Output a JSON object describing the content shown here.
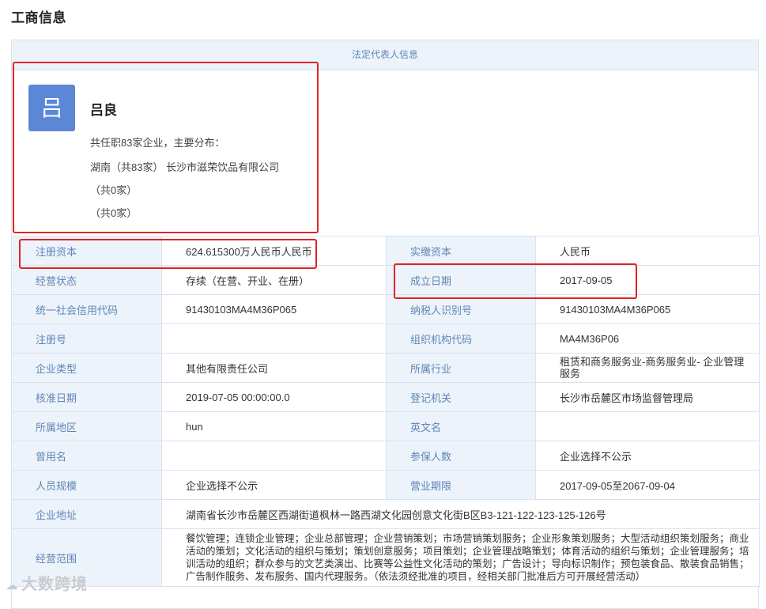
{
  "page_title": "工商信息",
  "section_header": "法定代表人信息",
  "person": {
    "avatar_char": "吕",
    "name": "吕良",
    "summary": "共任职83家企业，主要分布：",
    "lines": [
      "湖南（共83家） 长沙市滋荣饮品有限公司",
      "（共0家）",
      "（共0家）"
    ]
  },
  "fields": {
    "reg_capital": {
      "label": "注册资本",
      "value": "624.615300万人民币人民币"
    },
    "paid_capital": {
      "label": "实缴资本",
      "value": "人民币"
    },
    "status": {
      "label": "经营状态",
      "value": "存续（在营、开业、在册）"
    },
    "founded": {
      "label": "成立日期",
      "value": "2017-09-05"
    },
    "credit_code": {
      "label": "统一社会信用代码",
      "value": "91430103MA4M36P065"
    },
    "taxpayer_id": {
      "label": "纳税人识别号",
      "value": "91430103MA4M36P065"
    },
    "reg_no": {
      "label": "注册号",
      "value": ""
    },
    "org_code": {
      "label": "组织机构代码",
      "value": "MA4M36P06"
    },
    "company_type": {
      "label": "企业类型",
      "value": "其他有限责任公司"
    },
    "industry": {
      "label": "所属行业",
      "value": "租赁和商务服务业-商务服务业- 企业管理服务"
    },
    "approval_date": {
      "label": "核准日期",
      "value": "2019-07-05 00:00:00.0"
    },
    "authority": {
      "label": "登记机关",
      "value": "长沙市岳麓区市场监督管理局"
    },
    "region": {
      "label": "所属地区",
      "value": "hun"
    },
    "english_name": {
      "label": "英文名",
      "value": ""
    },
    "former_name": {
      "label": "曾用名",
      "value": ""
    },
    "insured": {
      "label": "参保人数",
      "value": "企业选择不公示"
    },
    "staff_size": {
      "label": "人员规模",
      "value": "企业选择不公示"
    },
    "term": {
      "label": "营业期限",
      "value": "2017-09-05至2067-09-04"
    },
    "address": {
      "label": "企业地址",
      "value": "湖南省长沙市岳麓区西湖街道枫林一路西湖文化园创意文化街B区B3-121-122-123-125-126号"
    },
    "scope": {
      "label": "经营范围",
      "value": "餐饮管理；连锁企业管理；企业总部管理；企业营销策划；市场营销策划服务；企业形象策划服务；大型活动组织策划服务；商业活动的策划；文化活动的组织与策划；策划创意服务；项目策划；企业管理战略策划；体育活动的组织与策划；企业管理服务；培训活动的组织；群众参与的文艺类演出、比赛等公益性文化活动的策划；广告设计；导向标识制作；预包装食品、散装食品销售；广告制作服务、发布服务、国内代理服务。（依法须经批准的项目，经相关部门批准后方可开展经营活动）"
    }
  },
  "watermark": {
    "icon": "cloud-logo-icon",
    "text": "大数跨境"
  },
  "colors": {
    "highlight": "#e02424",
    "label_bg": "#edf3fa",
    "label_text": "#5f86b7",
    "avatar_bg": "#5b87d6"
  }
}
